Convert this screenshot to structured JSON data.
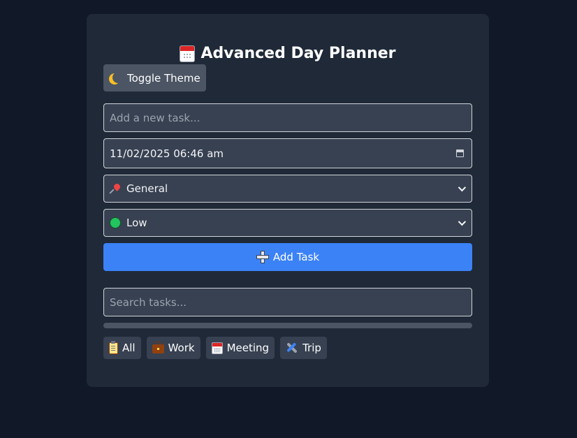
{
  "app": {
    "title": "Advanced Day Planner",
    "title_icon": "calendar-icon"
  },
  "toolbar": {
    "theme_label": "Toggle Theme",
    "theme_icon": "moon-icon"
  },
  "form": {
    "task_input": {
      "placeholder": "Add a new task...",
      "value": ""
    },
    "datetime": {
      "value": "11/02/2025 06:46 am"
    },
    "category": {
      "selected": "General",
      "icon": "pin-icon"
    },
    "priority": {
      "selected": "Low",
      "icon": "green-circle-icon"
    },
    "add_button_label": "Add Task",
    "add_button_icon": "plus-icon"
  },
  "search": {
    "placeholder": "Search tasks...",
    "value": ""
  },
  "progress": {
    "fraction": 0
  },
  "filters": [
    {
      "label": "All",
      "icon": "clipboard-icon"
    },
    {
      "label": "Work",
      "icon": "briefcase-icon"
    },
    {
      "label": "Meeting",
      "icon": "calendar-icon"
    },
    {
      "label": "Trip",
      "icon": "airplane-icon"
    }
  ],
  "colors": {
    "page_bg": "#111827",
    "card_bg": "#1f2937",
    "field_bg": "#374151",
    "accent": "#3b82f6",
    "secondary_button": "#4b5563"
  }
}
